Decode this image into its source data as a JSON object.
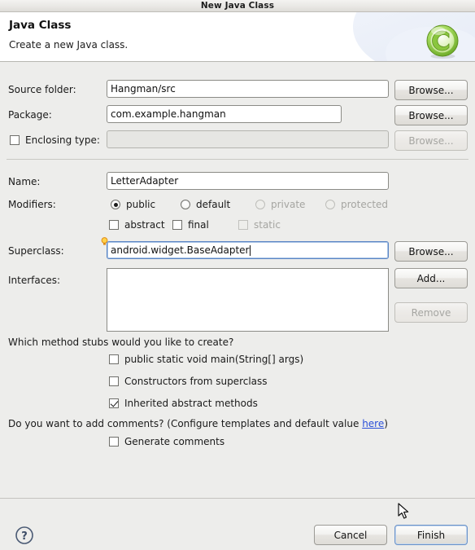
{
  "window": {
    "title": "New Java Class"
  },
  "header": {
    "title": "Java Class",
    "description": "Create a new Java class.",
    "icon": "java-class-wizard-icon"
  },
  "form": {
    "source_folder": {
      "label": "Source folder:",
      "value": "Hangman/src",
      "browse_label": "Browse..."
    },
    "package": {
      "label": "Package:",
      "value": "com.example.hangman",
      "browse_label": "Browse..."
    },
    "enclosing_type": {
      "label": "Enclosing type:",
      "checked": false,
      "value": "",
      "browse_label": "Browse...",
      "enabled": false
    },
    "name": {
      "label": "Name:",
      "value": "LetterAdapter"
    },
    "modifiers": {
      "label": "Modifiers:",
      "access": [
        {
          "label": "public",
          "selected": true,
          "enabled": true
        },
        {
          "label": "default",
          "selected": false,
          "enabled": true
        },
        {
          "label": "private",
          "selected": false,
          "enabled": false
        },
        {
          "label": "protected",
          "selected": false,
          "enabled": false
        }
      ],
      "flags": [
        {
          "label": "abstract",
          "checked": false,
          "enabled": true
        },
        {
          "label": "final",
          "checked": false,
          "enabled": true
        },
        {
          "label": "static",
          "checked": false,
          "enabled": false
        }
      ]
    },
    "superclass": {
      "label": "Superclass:",
      "value": "android.widget.BaseAdapter",
      "browse_label": "Browse...",
      "hint_icon": "lightbulb-icon"
    },
    "interfaces": {
      "label": "Interfaces:",
      "items": [],
      "add_label": "Add...",
      "remove_label": "Remove",
      "remove_enabled": false
    }
  },
  "stubs": {
    "question": "Which method stubs would you like to create?",
    "options": [
      {
        "label": "public static void main(String[] args)",
        "checked": false
      },
      {
        "label": "Constructors from superclass",
        "checked": false
      },
      {
        "label": "Inherited abstract methods",
        "checked": true
      }
    ]
  },
  "comments": {
    "question_prefix": "Do you want to add comments? (Configure templates and default value ",
    "link_label": "here",
    "question_suffix": ")",
    "option": {
      "label": "Generate comments",
      "checked": false
    }
  },
  "footer": {
    "help_label": "?",
    "cancel_label": "Cancel",
    "finish_label": "Finish"
  },
  "colors": {
    "accent_link": "#2b4fd8",
    "focus_border": "#5a84c4",
    "dialog_bg": "#ededeb",
    "icon_green": "#86c440"
  }
}
